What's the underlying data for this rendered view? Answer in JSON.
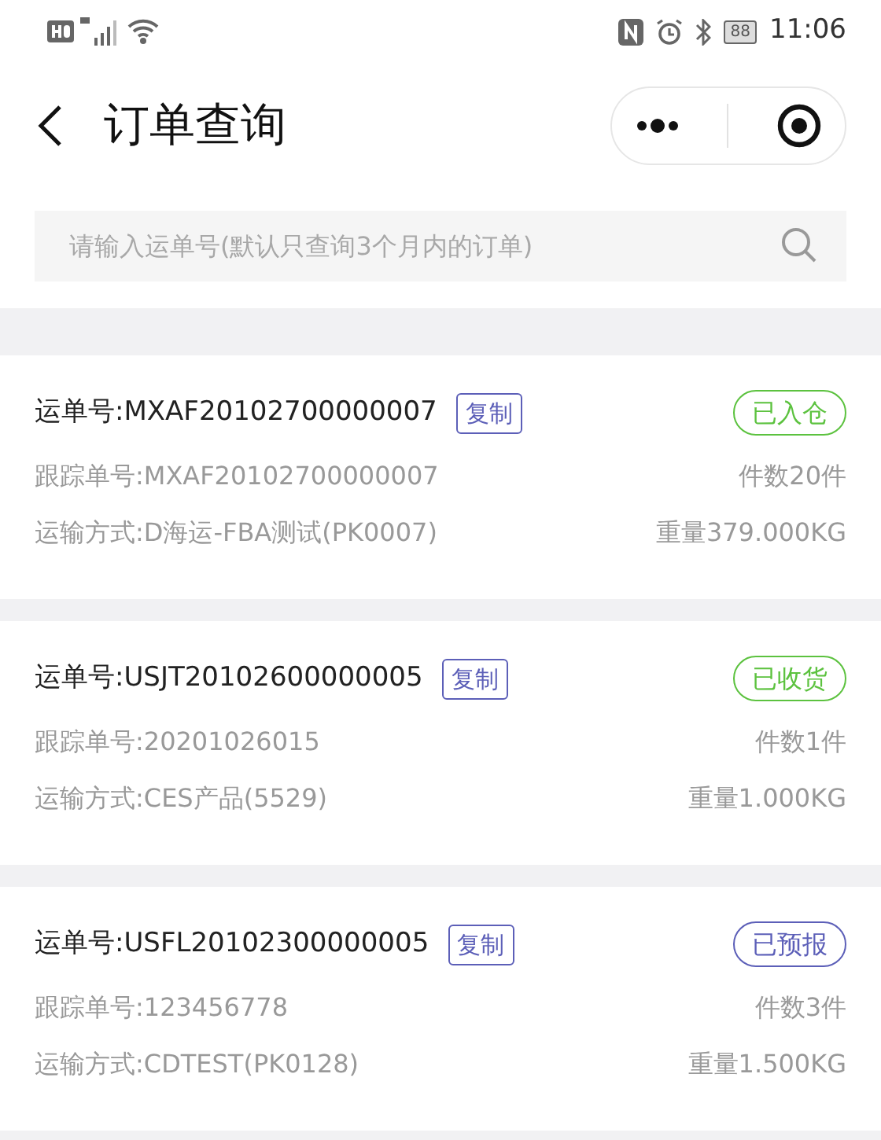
{
  "status_bar": {
    "battery": "88",
    "time": "11:06"
  },
  "header": {
    "title": "订单查询"
  },
  "search": {
    "placeholder": "请输入运单号(默认只查询3个月内的订单)"
  },
  "orders": [
    {
      "waybill": "运单号:MXAF20102700000007",
      "copy": "复制",
      "status": "已入仓",
      "color": "#5cc23f",
      "tracking": "跟踪单号:MXAF20102700000007",
      "pieces": "件数20件",
      "method": "运输方式:D海运-FBA测试(PK0007)",
      "weight": "重量379.000KG"
    },
    {
      "waybill": "运单号:USJT20102600000005",
      "copy": "复制",
      "status": "已收货",
      "color": "#5cc23f",
      "tracking": "跟踪单号:20201026015",
      "pieces": "件数1件",
      "method": "运输方式:CES产品(5529)",
      "weight": "重量1.000KG"
    },
    {
      "waybill": "运单号:USFL20102300000005",
      "copy": "复制",
      "status": "已预报",
      "color": "#5c5fb8",
      "tracking": "跟踪单号:123456778",
      "pieces": "件数3件",
      "method": "运输方式:CDTEST(PK0128)",
      "weight": "重量1.500KG"
    }
  ]
}
